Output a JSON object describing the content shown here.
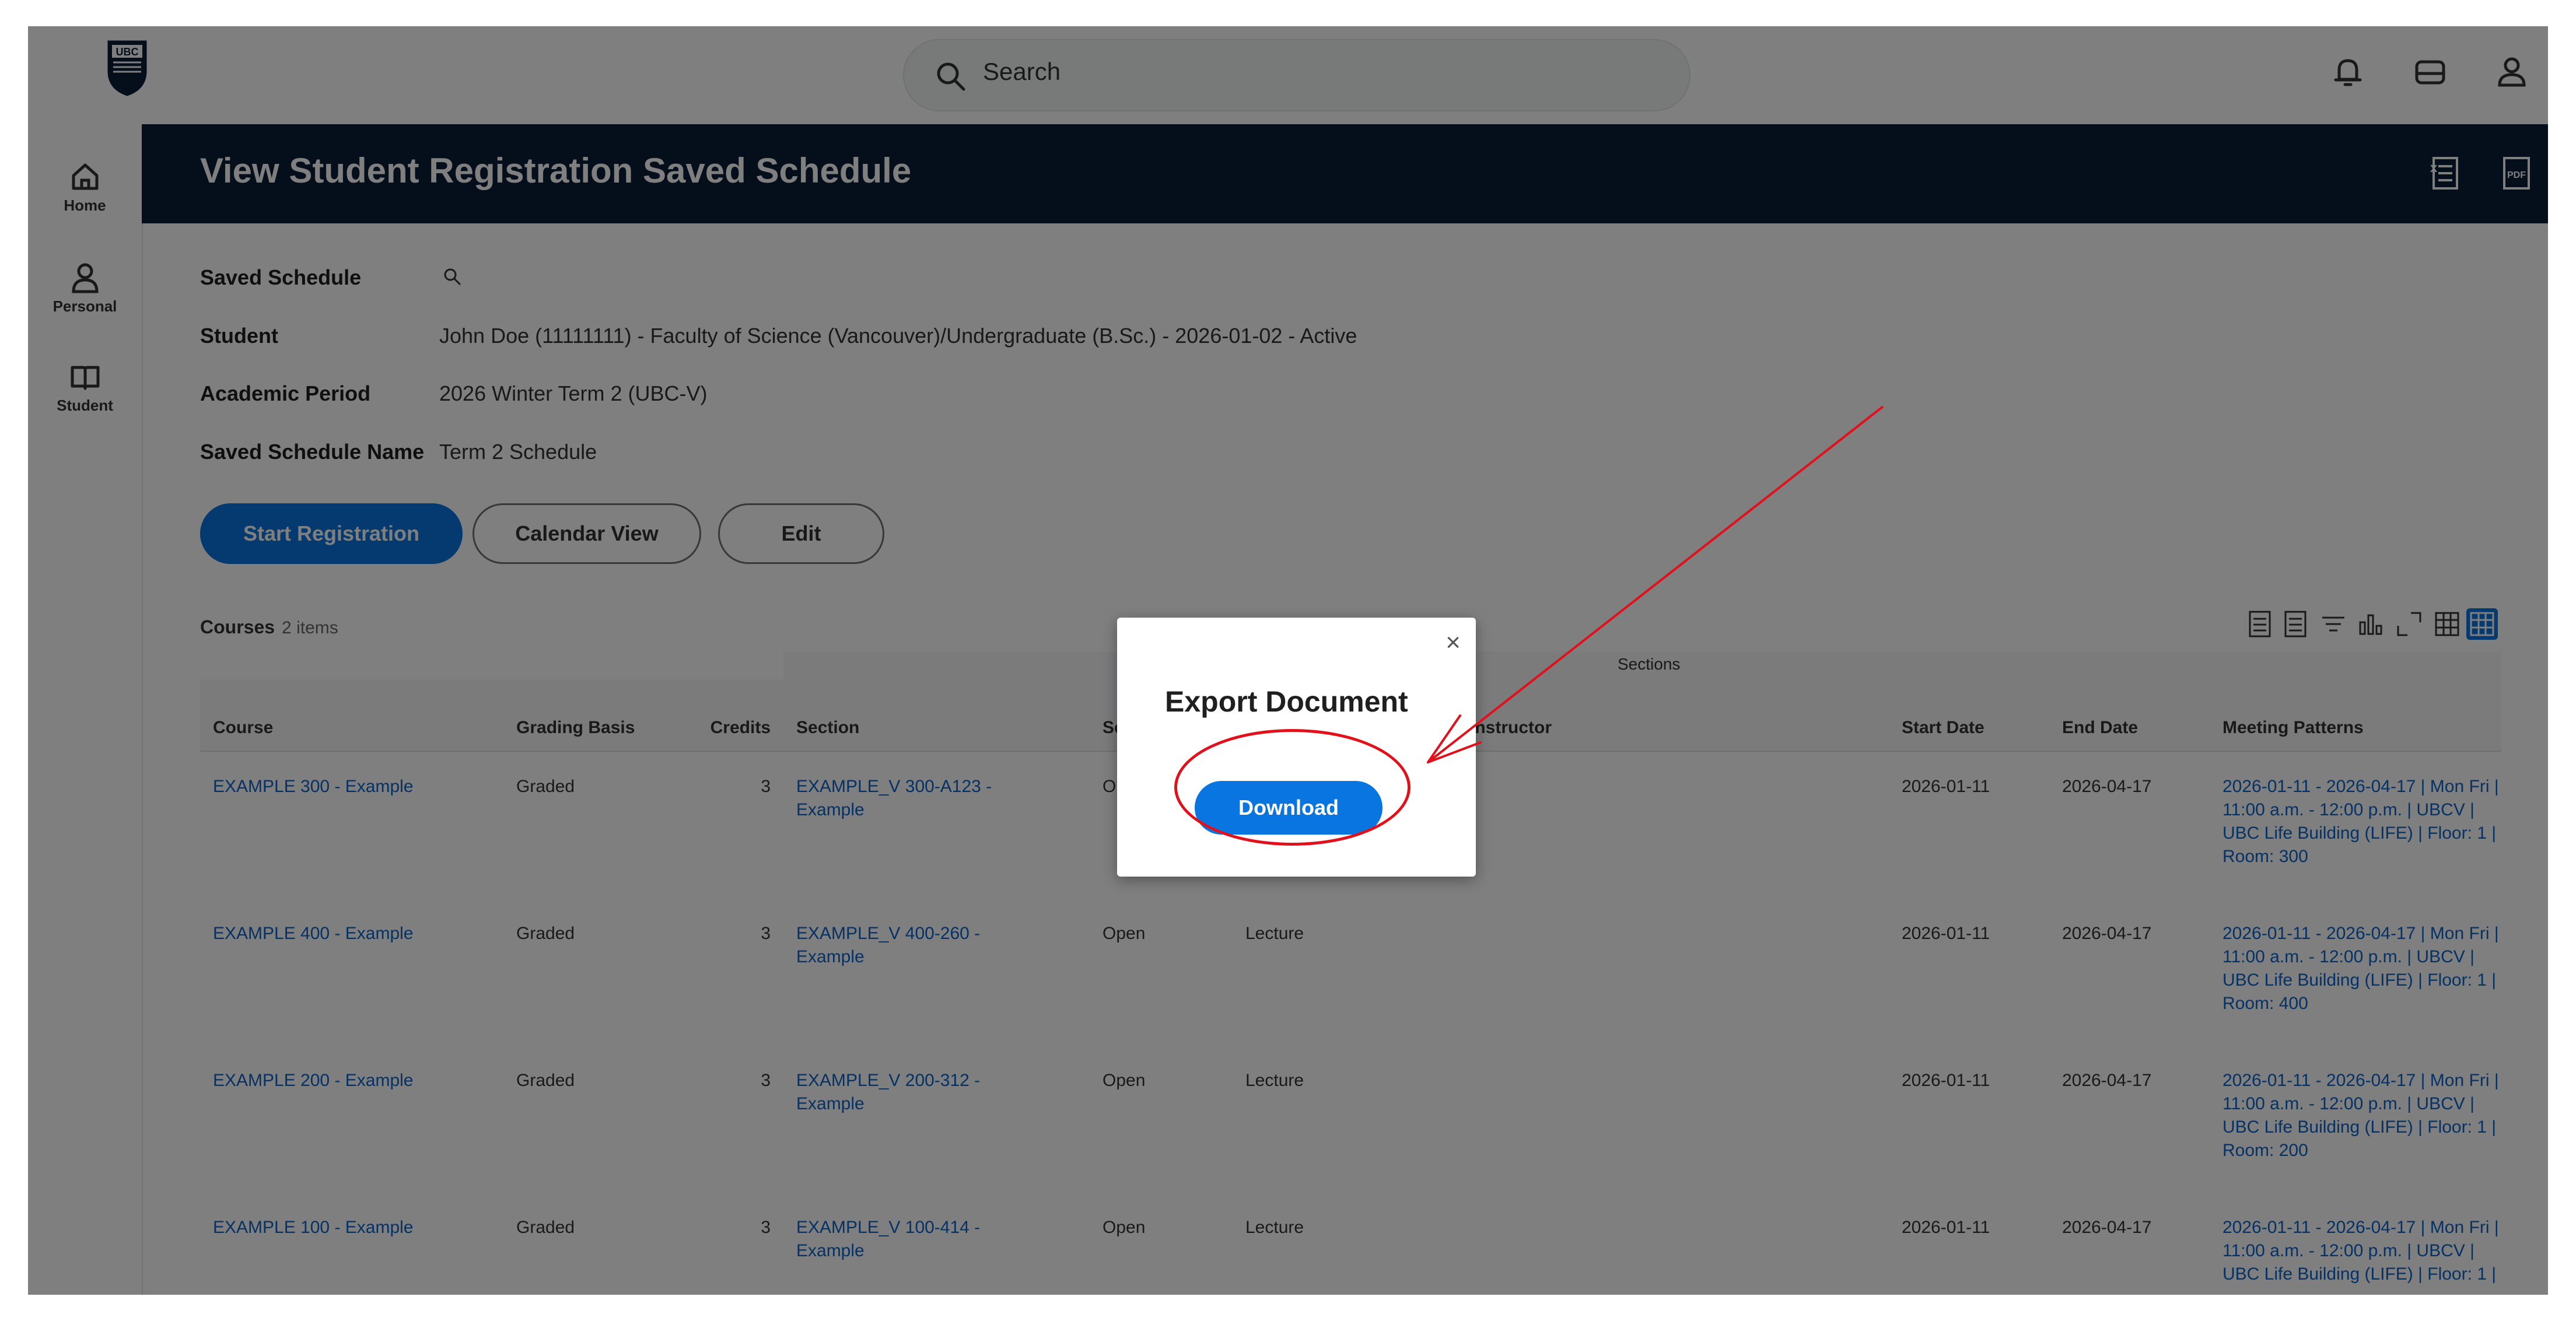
{
  "topbar": {
    "search_placeholder": "Search",
    "icons": [
      "notifications-icon",
      "inbox-icon",
      "profile-icon"
    ]
  },
  "sidebar": {
    "items": [
      {
        "label": "Home",
        "icon": "home-icon"
      },
      {
        "label": "Personal",
        "icon": "person-icon"
      },
      {
        "label": "Student",
        "icon": "book-icon"
      }
    ]
  },
  "header": {
    "title": "View Student Registration Saved Schedule",
    "icons": [
      "export-excel-icon",
      "export-pdf-icon"
    ]
  },
  "fields": [
    {
      "label": "Saved Schedule",
      "value": ""
    },
    {
      "label": "Student",
      "value": "John Doe (11111111) - Faculty of Science (Vancouver)/Undergraduate (B.Sc.) - 2026-01-02 - Active"
    },
    {
      "label": "Academic Period",
      "value": "2026 Winter Term 2 (UBC-V)"
    },
    {
      "label": "Saved Schedule Name",
      "value": "Term 2 Schedule"
    }
  ],
  "buttons": {
    "start_registration": "Start Registration",
    "calendar_view": "Calendar View",
    "edit": "Edit"
  },
  "courses": {
    "label": "Courses",
    "count": "2 items",
    "group_header": "Sections",
    "columns": [
      "Course",
      "Grading Basis",
      "Credits",
      "Section",
      "Se",
      "",
      "Instructor",
      "Start Date",
      "End Date",
      "Meeting Patterns"
    ],
    "rows": [
      {
        "course": "EXAMPLE 300 - Example",
        "grading": "Graded",
        "credits": "3",
        "section": "EXAMPLE_V 300-A123 -",
        "section2": "Example",
        "status": "Op",
        "format": "",
        "start": "2026-01-11",
        "end": "2026-04-17",
        "mp": [
          "2026-01-11 - 2026-04-17 | Mon Fri |",
          "11:00 a.m. - 12:00 p.m. | UBCV |",
          "UBC Life Building (LIFE) | Floor: 1 |",
          "Room: 300"
        ]
      },
      {
        "course": "EXAMPLE 400 - Example",
        "grading": "Graded",
        "credits": "3",
        "section": "EXAMPLE_V 400-260 -",
        "section2": "Example",
        "status": "Open",
        "format": "Lecture",
        "start": "2026-01-11",
        "end": "2026-04-17",
        "mp": [
          "2026-01-11 - 2026-04-17 | Mon Fri |",
          "11:00 a.m. - 12:00 p.m. | UBCV |",
          "UBC Life Building (LIFE) | Floor: 1 |",
          "Room: 400"
        ]
      },
      {
        "course": "EXAMPLE 200 - Example",
        "grading": "Graded",
        "credits": "3",
        "section": "EXAMPLE_V 200-312 -",
        "section2": "Example",
        "status": "Open",
        "format": "Lecture",
        "start": "2026-01-11",
        "end": "2026-04-17",
        "mp": [
          "2026-01-11 - 2026-04-17 | Mon Fri |",
          "11:00 a.m. - 12:00 p.m. | UBCV |",
          "UBC Life Building (LIFE) | Floor: 1 |",
          "Room: 200"
        ]
      },
      {
        "course": "EXAMPLE 100 - Example",
        "grading": "Graded",
        "credits": "3",
        "section": "EXAMPLE_V 100-414 -",
        "section2": "Example",
        "status": "Open",
        "format": "Lecture",
        "start": "2026-01-11",
        "end": "2026-04-17",
        "mp": [
          "2026-01-11 - 2026-04-17 | Mon Fri |",
          "11:00 a.m. - 12:00 p.m. | UBCV |",
          "UBC Life Building (LIFE) | Floor: 1 |",
          ""
        ]
      }
    ]
  },
  "modal": {
    "title": "Export Document",
    "download_label": "Download",
    "close_glyph": "×"
  },
  "colors": {
    "header_bg": "#0a1c36",
    "primary": "#0875e1",
    "link": "#0a63c9",
    "annotation": "#e2101b"
  }
}
